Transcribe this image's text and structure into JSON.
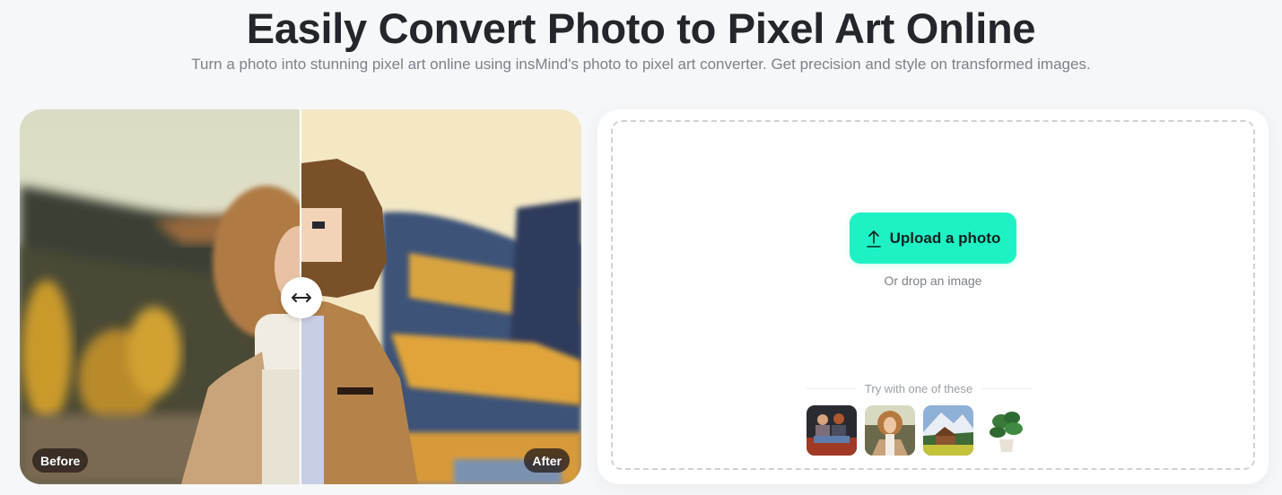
{
  "header": {
    "title": "Easily Convert Photo to Pixel Art Online",
    "subtitle": "Turn a photo into stunning pixel art online using insMind's photo to pixel art converter. Get precision and style on transformed images."
  },
  "compare": {
    "before_label": "Before",
    "after_label": "After",
    "handle_icon": "left-right-arrow-icon",
    "split_position": 0.5
  },
  "upload": {
    "button_label": "Upload a photo",
    "button_icon": "upload-icon",
    "drop_text": "Or drop an image",
    "try_label": "Try with one of these",
    "samples": [
      {
        "name": "two-people-sitting"
      },
      {
        "name": "curly-hair-woman"
      },
      {
        "name": "mountain-cabin"
      },
      {
        "name": "potted-plant"
      }
    ]
  },
  "colors": {
    "accent": "#1ef2c5",
    "title": "#24262b",
    "muted": "#7d8189",
    "background": "#f6f7f9"
  }
}
